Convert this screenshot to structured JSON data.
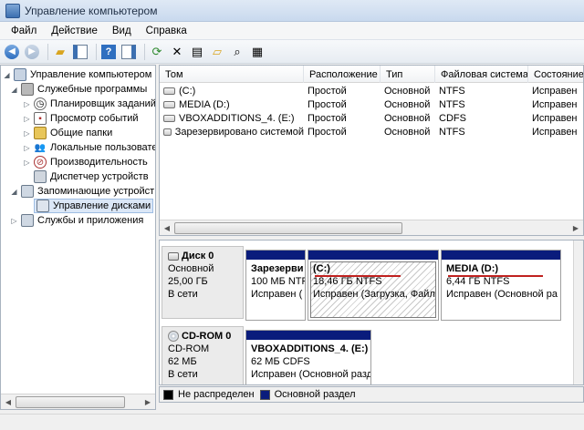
{
  "window": {
    "title": "Управление компьютером"
  },
  "menu": [
    "Файл",
    "Действие",
    "Вид",
    "Справка"
  ],
  "tree": {
    "root": "Управление компьютером (л",
    "system_tools": "Служебные программы",
    "task_scheduler": "Планировщик заданий",
    "event_viewer": "Просмотр событий",
    "shared_folders": "Общие папки",
    "local_users": "Локальные пользовате",
    "performance": "Производительность",
    "device_manager": "Диспетчер устройств",
    "storage": "Запоминающие устройст",
    "disk_management": "Управление дисками",
    "services": "Службы и приложения"
  },
  "volumes": {
    "headers": [
      "Том",
      "Расположение",
      "Тип",
      "Файловая система",
      "Состояние"
    ],
    "rows": [
      [
        "(C:)",
        "Простой",
        "Основной",
        "NTFS",
        "Исправен"
      ],
      [
        "MEDIA (D:)",
        "Простой",
        "Основной",
        "NTFS",
        "Исправен"
      ],
      [
        "VBOXADDITIONS_4. (E:)",
        "Простой",
        "Основной",
        "CDFS",
        "Исправен"
      ],
      [
        "Зарезервировано системой",
        "Простой",
        "Основной",
        "NTFS",
        "Исправен"
      ]
    ]
  },
  "disk0": {
    "name": "Диск 0",
    "type": "Основной",
    "size": "25,00 ГБ",
    "status": "В сети",
    "partitions": [
      {
        "name": "Зарезерви",
        "size": "100 МБ NTF",
        "status": "Исправен ("
      },
      {
        "name": "(C:)",
        "size": "18,46 ГБ NTFS",
        "status": "Исправен (Загрузка, Файл п"
      },
      {
        "name": "MEDIA  (D:)",
        "size": "6,44 ГБ NTFS",
        "status": "Исправен (Основной ра"
      }
    ]
  },
  "cdrom0": {
    "name": "CD-ROM 0",
    "type": "CD-ROM",
    "size": "62 МБ",
    "status": "В сети",
    "partition": {
      "name": "VBOXADDITIONS_4.  (E:)",
      "size": "62 МБ CDFS",
      "status": "Исправен (Основной разд"
    }
  },
  "legend": {
    "unallocated": "Не распределен",
    "primary": "Основной раздел",
    "unallocated_color": "#000000",
    "primary_color": "#0a1c7c"
  },
  "colors": {
    "partition_bar": "#0a1c7c",
    "underline": "#c0211f"
  }
}
